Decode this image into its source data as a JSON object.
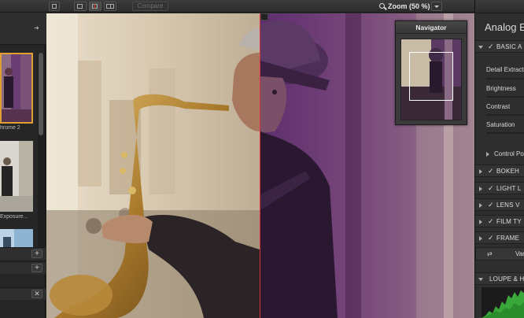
{
  "toolbar": {
    "compare_label": "Compare",
    "zoom_label": "Zoom (50 %)"
  },
  "filmstrip": {
    "items": [
      {
        "label": "hrome 2",
        "selected": true
      },
      {
        "label": "Exposure...",
        "selected": false
      },
      {
        "label": "",
        "selected": false
      }
    ]
  },
  "navigator": {
    "title": "Navigator"
  },
  "right_panel": {
    "title": "Analog E",
    "basic_section": "BASIC A",
    "params": [
      "Detail Extract",
      "Brightness",
      "Contrast",
      "Saturation"
    ],
    "control_points": "Control Po",
    "sections": [
      "BOKEH",
      "LIGHT L",
      "LENS V",
      "FILM TY",
      "FRAME"
    ],
    "variations_label": "Var",
    "loupe_section": "LOUPE & H"
  },
  "colors": {
    "split_line": "#d8323a",
    "selection_border": "#e0a030",
    "histogram_green": "#3fbf3f"
  }
}
